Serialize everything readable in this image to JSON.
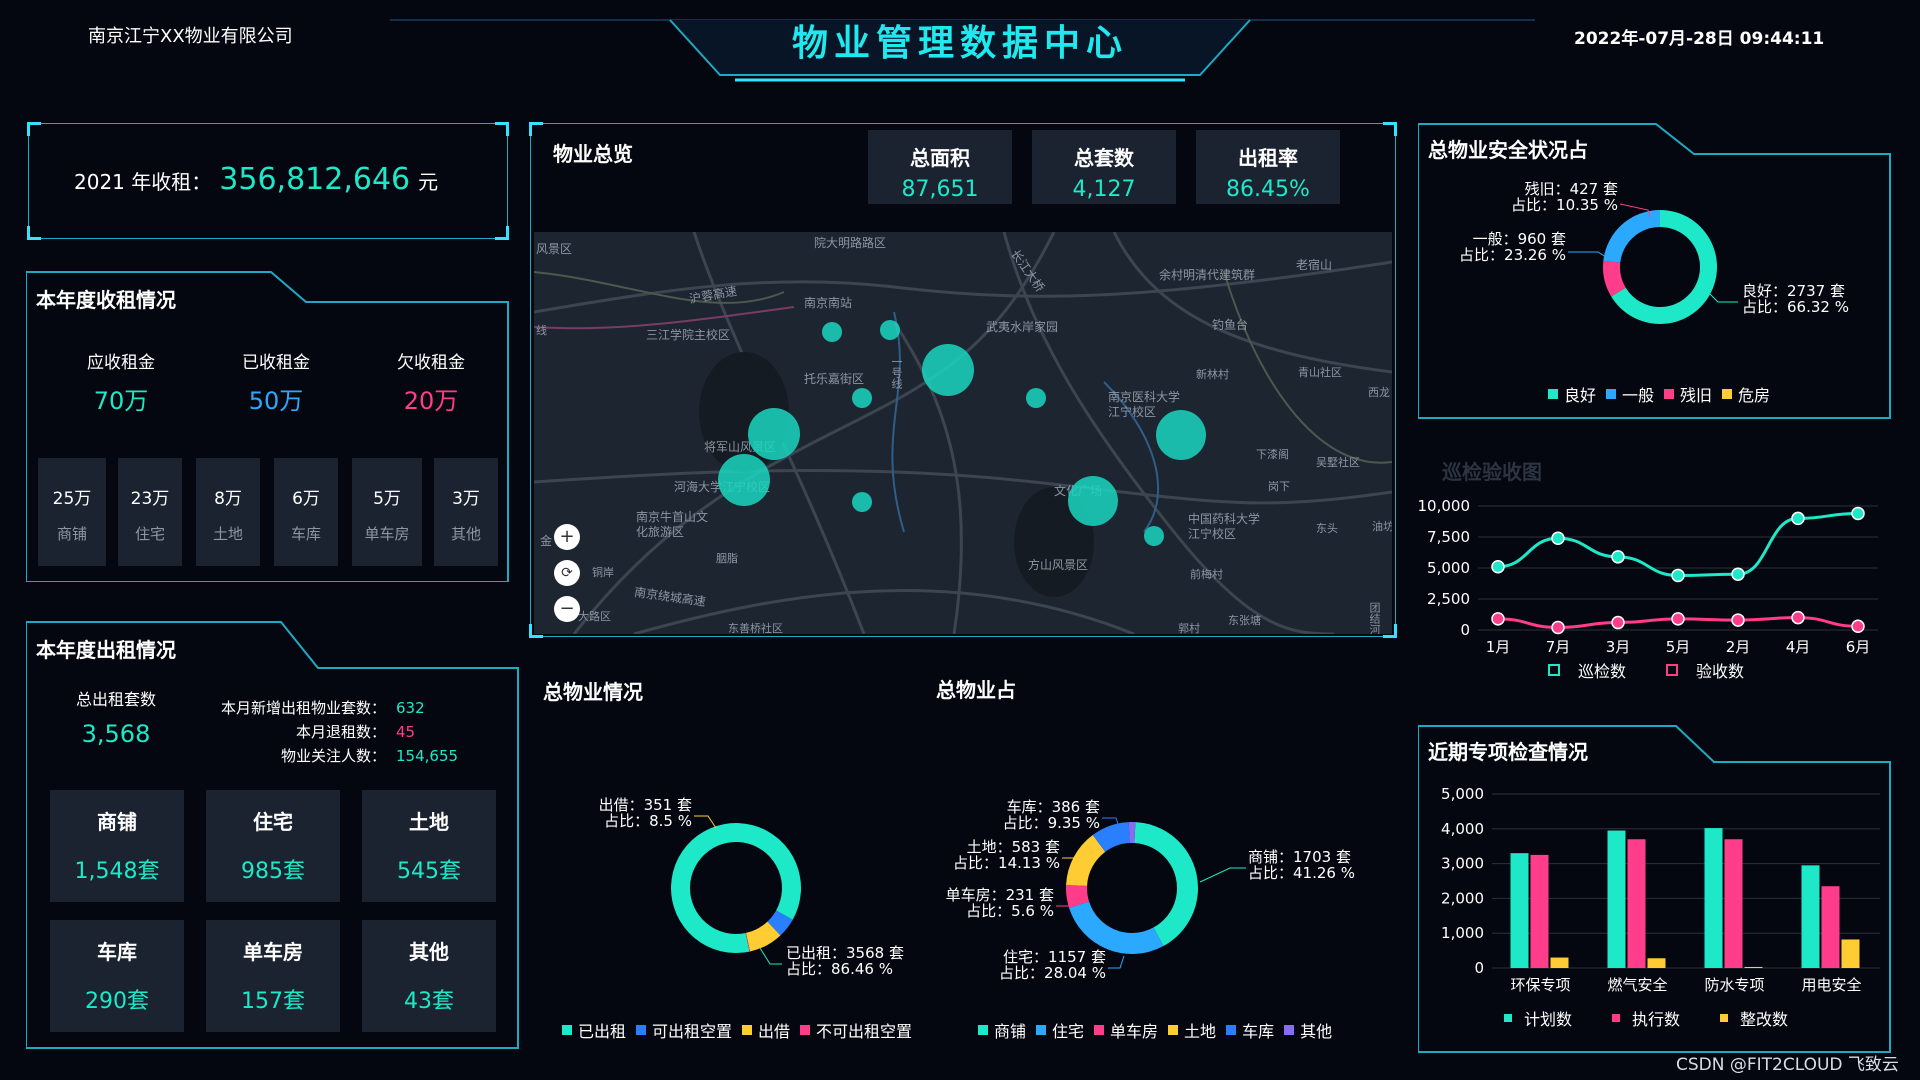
{
  "header": {
    "company": "南京江宁XX物业有限公司",
    "title": "物业管理数据中心",
    "datetime": "2022年-07月-28日 09:44:11"
  },
  "income": {
    "label": "2021 年收租：",
    "value": "356,812,646",
    "unit": "元"
  },
  "rent_collection": {
    "title": "本年度收租情况",
    "summary": [
      {
        "label": "应收租金",
        "value": "70万"
      },
      {
        "label": "已收租金",
        "value": "50万"
      },
      {
        "label": "欠收租金",
        "value": "20万"
      }
    ],
    "categories": [
      {
        "value": "25万",
        "label": "商铺"
      },
      {
        "value": "23万",
        "label": "住宅"
      },
      {
        "value": "8万",
        "label": "土地"
      },
      {
        "value": "6万",
        "label": "车库"
      },
      {
        "value": "5万",
        "label": "单车房"
      },
      {
        "value": "3万",
        "label": "其他"
      }
    ]
  },
  "rental": {
    "title": "本年度出租情况",
    "total_label": "总出租套数",
    "total_value": "3,568",
    "metrics": [
      {
        "label": "本月新增出租物业套数：",
        "value": "632"
      },
      {
        "label": "本月退租数：",
        "value": "45"
      },
      {
        "label": "物业关注人数：",
        "value": "154,655"
      }
    ],
    "tiles": [
      {
        "label": "商铺",
        "value": "1,548套"
      },
      {
        "label": "住宅",
        "value": "985套"
      },
      {
        "label": "土地",
        "value": "545套"
      },
      {
        "label": "车库",
        "value": "290套"
      },
      {
        "label": "单车房",
        "value": "157套"
      },
      {
        "label": "其他",
        "value": "43套"
      }
    ]
  },
  "overview": {
    "title": "物业总览",
    "stats": [
      {
        "label": "总面积",
        "value": "87,651"
      },
      {
        "label": "总套数",
        "value": "4,127"
      },
      {
        "label": "出租率",
        "value": "86.45%"
      }
    ],
    "map_labels": [
      "风景区",
      "院大明路路区",
      "沪蓉高速",
      "南京南站",
      "三江学院主校区",
      "托乐嘉街区",
      "武夷水岸家园",
      "余村明清代建筑群",
      "老宿山",
      "钓鱼台",
      "新林村",
      "青山社区",
      "西龙",
      "南京医科大学江宁校区",
      "将军山风景区",
      "河海大学江宁校区",
      "下漆阁",
      "吴墅社区",
      "南京牛首山文化旅游区",
      "方山风景区",
      "中国药科大学江宁校区",
      "东头",
      "油坊",
      "胭脂",
      "南京绕城高速",
      "东善桥社区",
      "前梅村",
      "东张塘",
      "郭村",
      "团结河",
      "大路区",
      "铜岸",
      "金",
      "线",
      "文化广场",
      "岗下",
      "一号线",
      "长江大桥"
    ],
    "zoom_icons": [
      "plus-icon",
      "locate-icon",
      "minus-icon"
    ]
  },
  "safety": {
    "title": "总物业安全状况占",
    "labels": [
      {
        "name": "残旧",
        "count": "427 套",
        "pct": "10.35 %"
      },
      {
        "name": "一般",
        "count": "960 套",
        "pct": "23.26 %"
      },
      {
        "name": "良好",
        "count": "2737 套",
        "pct": "66.32 %"
      }
    ],
    "count_prefix": "：",
    "pct_prefix": "占比：",
    "legend": [
      "良好",
      "一般",
      "残旧",
      "危房"
    ],
    "colors": [
      "#1de9c9",
      "#2aa9ff",
      "#ff3d8b",
      "#ffcc33"
    ],
    "chart_data": {
      "type": "pie",
      "categories": [
        "良好",
        "一般",
        "残旧",
        "危房"
      ],
      "values": [
        66.32,
        23.26,
        10.35,
        0.07
      ]
    }
  },
  "inspection": {
    "title": "巡检验收图",
    "legend": [
      "巡检数",
      "验收数"
    ],
    "colors": [
      "#1de9c9",
      "#ff3d8b"
    ],
    "chart_data": {
      "type": "line",
      "categories": [
        "1月",
        "7月",
        "3月",
        "5月",
        "2月",
        "4月",
        "6月"
      ],
      "series": [
        {
          "name": "巡检数",
          "values": [
            5100,
            7400,
            5900,
            4400,
            4500,
            9000,
            9400
          ]
        },
        {
          "name": "验收数",
          "values": [
            900,
            200,
            600,
            900,
            800,
            1000,
            300
          ]
        }
      ],
      "yticks": [
        "10,000",
        "7,500",
        "5,000",
        "2,500",
        "0"
      ],
      "ylim": [
        0,
        10000
      ]
    }
  },
  "property": {
    "title": "总物业情况",
    "labels": [
      {
        "name": "出借",
        "count": "351 套",
        "pct": "8.5 %"
      },
      {
        "name": "已出租",
        "count": "3568 套",
        "pct": "86.46 %"
      }
    ],
    "legend": [
      "已出租",
      "可出租空置",
      "出借",
      "不可出租空置"
    ],
    "colors": [
      "#1de9c9",
      "#2a7fff",
      "#ffcc33",
      "#ff3d8b"
    ],
    "chart_data": {
      "type": "pie",
      "categories": [
        "已出租",
        "可出租空置",
        "出借",
        "不可出租空置"
      ],
      "values": [
        86.46,
        4.9,
        8.5,
        0.14
      ]
    }
  },
  "property_share": {
    "title": "总物业占",
    "labels": [
      {
        "name": "车库",
        "count": "386 套",
        "pct": "9.35 %"
      },
      {
        "name": "土地",
        "count": "583 套",
        "pct": "14.13 %"
      },
      {
        "name": "单车房",
        "count": "231 套",
        "pct": "5.6 %"
      },
      {
        "name": "住宅",
        "count": "1157 套",
        "pct": "28.04 %"
      },
      {
        "name": "商铺",
        "count": "1703 套",
        "pct": "41.26 %"
      }
    ],
    "legend": [
      "商铺",
      "住宅",
      "单车房",
      "土地",
      "车库",
      "其他"
    ],
    "colors": [
      "#1de9c9",
      "#2aa9ff",
      "#ff3d8b",
      "#ffcc33",
      "#2a7fff",
      "#8a6cf0"
    ],
    "chart_data": {
      "type": "pie",
      "categories": [
        "商铺",
        "住宅",
        "单车房",
        "土地",
        "车库",
        "其他"
      ],
      "values": [
        41.26,
        28.04,
        5.6,
        14.13,
        9.35,
        1.62
      ]
    }
  },
  "special_checks": {
    "title": "近期专项检查情况",
    "legend": [
      "计划数",
      "执行数",
      "整改数"
    ],
    "colors": [
      "#1de9c9",
      "#ff3d8b",
      "#ffcc33"
    ],
    "chart_data": {
      "type": "bar",
      "categories": [
        "环保专项",
        "燃气安全",
        "防水专项",
        "用电安全"
      ],
      "series": [
        {
          "name": "计划数",
          "values": [
            3300,
            3950,
            4020,
            2950
          ]
        },
        {
          "name": "执行数",
          "values": [
            3250,
            3700,
            3700,
            2350
          ]
        },
        {
          "name": "整改数",
          "values": [
            300,
            280,
            30,
            820
          ]
        }
      ],
      "yticks": [
        "5,000",
        "4,000",
        "3,000",
        "2,000",
        "1,000",
        "0"
      ],
      "ylim": [
        0,
        5000
      ]
    }
  },
  "watermark": "CSDN @FIT2CLOUD 飞致云"
}
